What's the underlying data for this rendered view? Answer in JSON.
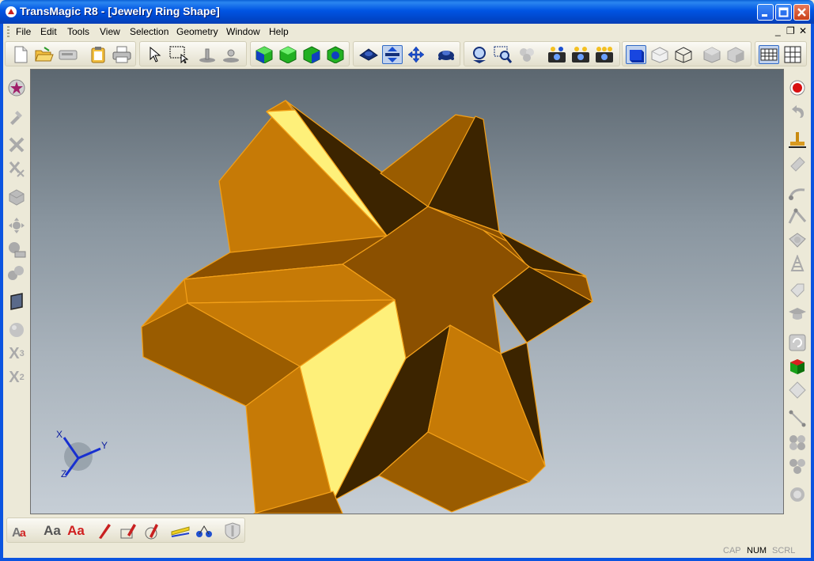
{
  "window": {
    "title": "TransMagic R8 - [Jewelry Ring Shape]",
    "buttons": {
      "minimize": "minimize-icon",
      "maximize": "maximize-icon",
      "close": "close-icon"
    }
  },
  "menubar": {
    "items": [
      "File",
      "Edit",
      "Tools",
      "View",
      "Selection",
      "Geometry",
      "Window",
      "Help"
    ],
    "mdi_controls": {
      "minimize": "_",
      "restore": "❐",
      "close": "✕"
    }
  },
  "toolbar": {
    "icons": [
      "new-file-icon",
      "open-file-icon",
      "save-icon",
      "clipboard-icon",
      "print-icon",
      "select-arrow-icon",
      "select-box-icon",
      "measure-icon",
      "measure2-icon",
      "view-shaded-icon",
      "view-edge-icon",
      "view-face-icon",
      "view-hidden-icon",
      "zoom-fit-icon",
      "rotate-icon",
      "pan-icon",
      "spin-icon",
      "zoom-in-icon",
      "zoom-window-icon",
      "orbit-icon",
      "camera-icon",
      "camera2-icon",
      "camera3-icon",
      "shaded-solid-icon",
      "shaded-white-icon",
      "wireframe-icon",
      "gray-cube-icon",
      "gray-cube2-icon",
      "grid-icon",
      "table-icon"
    ]
  },
  "left_toolbar": {
    "icons": [
      "star-icon",
      "tool-icon",
      "delete-icon",
      "x-delete-icon",
      "cube-icon",
      "move-icon",
      "keyboard-icon",
      "spheres-icon",
      "face-icon",
      "sphere-icon",
      "x-cubed-icon",
      "x-squared-icon"
    ],
    "labels": {
      "x3": "X",
      "x3_sup": "3",
      "x2": "X",
      "x2_sup": "2"
    }
  },
  "right_toolbar": {
    "icons": [
      "record-icon",
      "undo-icon",
      "stamp-icon",
      "eraser-icon",
      "curve-icon",
      "angle-icon",
      "prism-icon",
      "striped-icon",
      "tag-icon",
      "cap-icon",
      "refresh-icon",
      "color-cube-icon",
      "diamond-icon",
      "line-icon",
      "spheres2-icon",
      "spheres3-icon",
      "sphere-ring-icon"
    ]
  },
  "viewport": {
    "model_name": "Jewelry Ring Shape",
    "axis_labels": {
      "x": "X",
      "y": "Y",
      "z": "Z"
    },
    "colors": {
      "model_light": "#fef07a",
      "model_mid": "#d68a0e",
      "model_dark": "#8b5000",
      "model_shadow": "#3c2400",
      "edge": "#f3a018"
    }
  },
  "bottom_toolbar": {
    "icons": [
      "text-red-icon",
      "text-aa-icon",
      "text-aa-red-icon",
      "pen-icon",
      "pen2-icon",
      "pen3-icon",
      "ruler-icon",
      "node-icon",
      "shield-icon"
    ],
    "labels": {
      "aa1": "Aa",
      "aa2": "Aa"
    }
  },
  "statusbar": {
    "cap": "CAP",
    "num": "NUM",
    "scrl": "SCRL"
  }
}
